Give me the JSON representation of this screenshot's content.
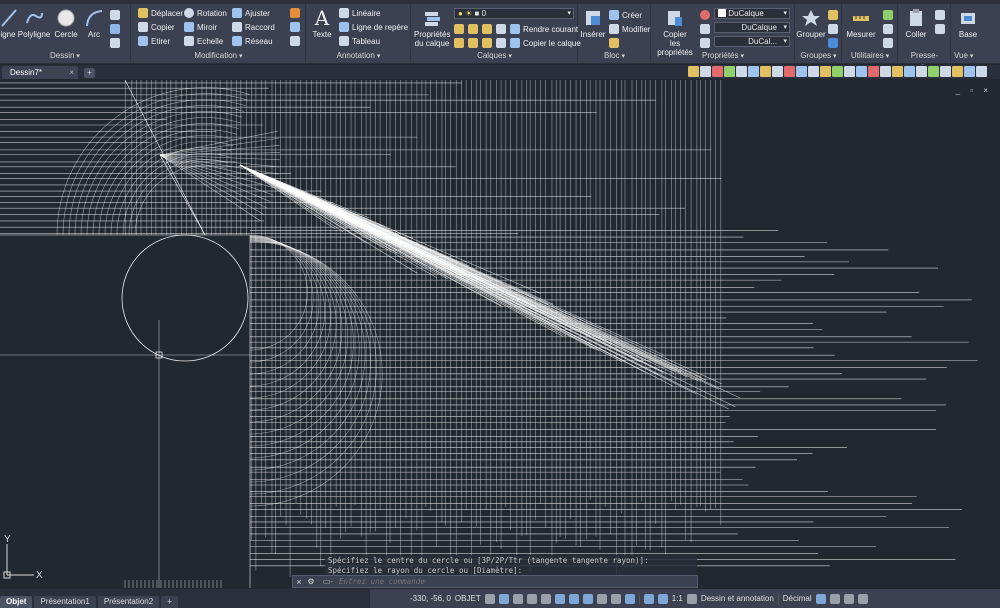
{
  "ribbon": {
    "panels": {
      "dessin": "Dessin",
      "modification": "Modification",
      "annotation": "Annotation",
      "calques": "Calques",
      "bloc": "Bloc",
      "proprietes": "Propriétés",
      "groupes": "Groupes",
      "utilitaires": "Utilitaires",
      "presse_papiers": "Presse-papiers",
      "vue": "Vue"
    },
    "dessin": {
      "ligne": "igne",
      "polyligne": "Polyligne",
      "cercle": "Cercle",
      "arc": "Arc"
    },
    "modification": {
      "deplacer": "Déplacer",
      "rotation": "Rotation",
      "ajuster": "Ajuster",
      "copier": "Copier",
      "miroir": "Miroir",
      "raccord": "Raccord",
      "etirer": "Etirer",
      "echelle": "Echelle",
      "reseau": "Réseau"
    },
    "annotation": {
      "texte": "Texte",
      "lineaire": "Linéaire",
      "ligne_repere": "Ligne de repère",
      "tableau": "Tableau"
    },
    "calques": {
      "proprietes_calque_1": "Propriétés",
      "proprietes_calque_2": "du calque",
      "current_layer": "0",
      "rendre_courant": "Rendre courant",
      "copier_calque": "Copier le calque"
    },
    "bloc": {
      "inserer": "Insérer",
      "creer": "Créer",
      "modifier": "Modifier"
    },
    "proprietes": {
      "copier_1": "Copier",
      "copier_2": "les propriétés",
      "color_value": "DuCalque",
      "linetype_value": "DuCalque",
      "lineweight_value": "DuCal..."
    },
    "groupes": {
      "grouper": "Grouper"
    },
    "utilitaires": {
      "mesurer": "Mesurer"
    },
    "presse_papiers": {
      "coller": "Coller"
    },
    "vue": {
      "base": "Base"
    }
  },
  "file_tabs": {
    "document": "Dessin7*",
    "close": "×",
    "new": "+"
  },
  "viewport": {
    "controls": "_ ▫ ×"
  },
  "command": {
    "history_line1": "Spécifiez le centre du cercle ou [3P/2P/Ttr (tangente tangente rayon)]:",
    "history_line2": "Spécifiez le rayon du cercle ou [Diamètre]:",
    "placeholder": "Entrez une commande",
    "close": "×",
    "wrench": "⚙",
    "prompt_icon": "▭-"
  },
  "layout_tabs": [
    "Objet",
    "Présentation1",
    "Présentation2",
    "+"
  ],
  "status": {
    "coords": "-330, -56, 0",
    "mode": "OBJET",
    "scale": "1:1",
    "workspace": "Dessin et annotation",
    "units": "Décimal"
  },
  "ucs": {
    "x": "X",
    "y": "Y"
  }
}
